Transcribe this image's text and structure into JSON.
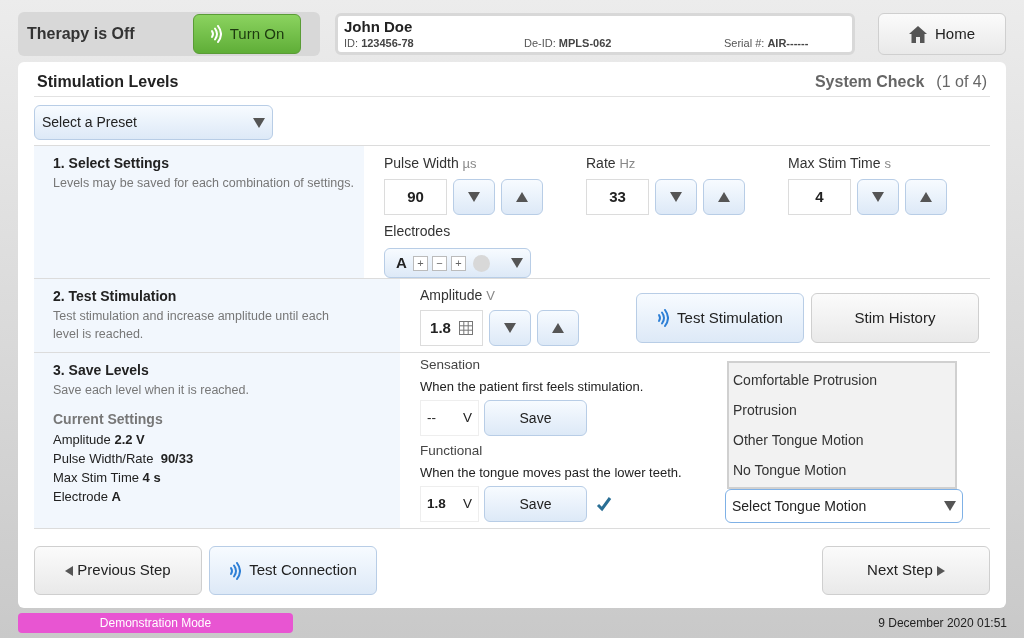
{
  "header": {
    "status": "Therapy is Off",
    "turn_on": "Turn On",
    "patient": {
      "name": "John Doe",
      "fields": [
        {
          "label": "ID:",
          "value": "123456-78"
        },
        {
          "label": "De-ID:",
          "value": "MPLS-062"
        },
        {
          "label": "Serial #:",
          "value": "AIR------"
        }
      ]
    },
    "home": "Home"
  },
  "panel": {
    "title": "Stimulation Levels",
    "step": "System Check",
    "step_count": "(1 of 4)"
  },
  "preset": {
    "value": "Select a Preset"
  },
  "select_settings": {
    "title": "1. Select Settings",
    "description": "Levels may be saved for each combination of settings.",
    "settings": [
      {
        "label": "Pulse Width",
        "unit": "µs",
        "value": "90"
      },
      {
        "label": "Rate",
        "unit": "Hz",
        "value": "33"
      },
      {
        "label": "Max Stim Time",
        "unit": "s",
        "value": "4"
      }
    ],
    "electrodes": {
      "label": "Electrodes",
      "letter": "A",
      "contacts": [
        "+",
        "−",
        "+"
      ]
    }
  },
  "test_stimulation": {
    "title": "2. Test Stimulation",
    "description": "Test stimulation and increase amplitude until each level is reached.",
    "amplitude": {
      "label": "Amplitude",
      "unit": "V",
      "value": "1.8"
    },
    "test_button": "Test Stimulation",
    "history_button": "Stim History"
  },
  "save_levels": {
    "title": "3. Save Levels",
    "description": "Save each level when it is reached.",
    "current_heading": "Current Settings",
    "current_lines": [
      "Amplitude **2.2 V**",
      "Pulse Width/Rate  **90/33**",
      "Max Stim Time **4 s**",
      "Electrode **A**"
    ],
    "levels": [
      {
        "label": "Sensation",
        "hint": "When the patient first feels stimulation.",
        "value": "--",
        "unit": "V",
        "button": "Save",
        "saved": false
      },
      {
        "label": "Functional",
        "hint": "When the tongue moves past the lower teeth.",
        "value": "1.8",
        "unit": "V",
        "button": "Save",
        "saved": true
      }
    ],
    "tongue_motion": {
      "value": "Select Tongue Motion",
      "expanded": true,
      "options": [
        "Comfortable Protrusion",
        "Protrusion",
        "Other Tongue Motion",
        "No Tongue Motion"
      ]
    }
  },
  "nav": {
    "previous": "Previous Step",
    "test_connection": "Test Connection",
    "next": "Next Step"
  },
  "status_bar": {
    "mode": "Demonstration Mode",
    "datetime": "9 December 2020 01:51"
  }
}
